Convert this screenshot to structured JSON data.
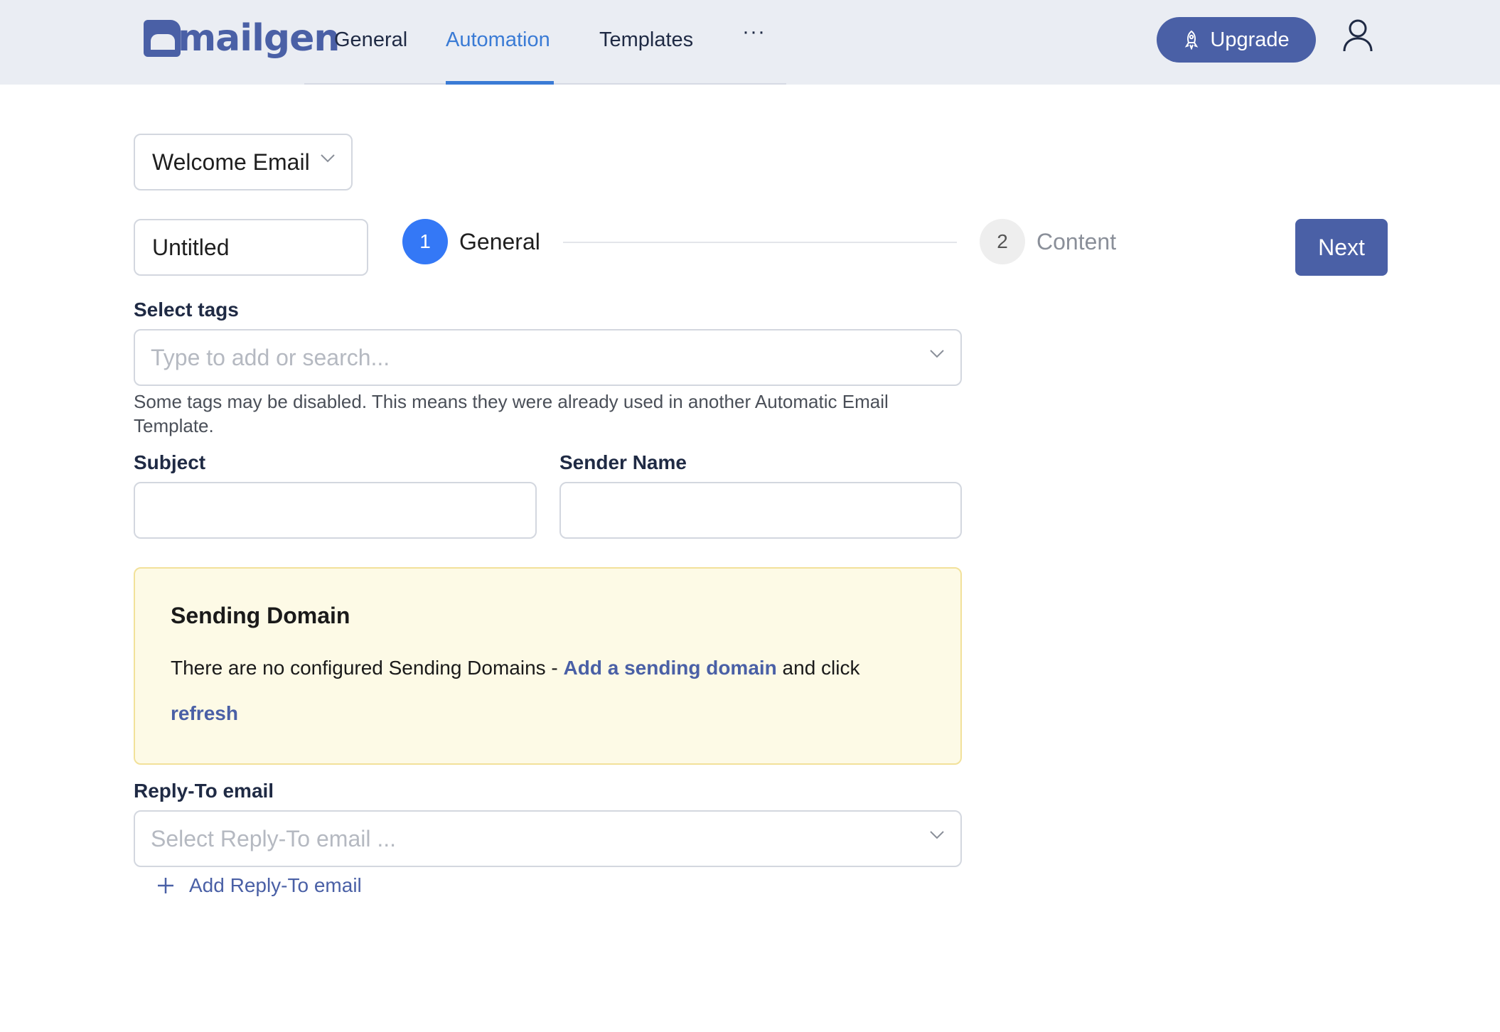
{
  "brand": {
    "name": "mailgen",
    "accent": "#4a60a6",
    "link_active": "#3a7bd5"
  },
  "nav": {
    "items": [
      {
        "label": "General"
      },
      {
        "label": "Automation",
        "active": true
      },
      {
        "label": "Templates"
      }
    ],
    "more_label": "···",
    "upgrade_label": "Upgrade",
    "upgrade_icon": "rocket-icon",
    "user_icon": "user-icon"
  },
  "template_select": {
    "value": "Welcome Email"
  },
  "name_field": {
    "value": "Untitled"
  },
  "steps": [
    {
      "number": "1",
      "label": "General",
      "state": "active"
    },
    {
      "number": "2",
      "label": "Content",
      "state": "inactive"
    }
  ],
  "next_label": "Next",
  "tags": {
    "label": "Select tags",
    "placeholder": "Type to add or search...",
    "hint": "Some tags may be disabled. This means they were already used in another Automatic Email Template."
  },
  "subject": {
    "label": "Subject",
    "value": ""
  },
  "sender_name": {
    "label": "Sender Name",
    "value": ""
  },
  "sending_domain": {
    "title": "Sending Domain",
    "text_before": "There are no configured Sending Domains - ",
    "link_add": "Add a sending domain",
    "text_after": " and click",
    "link_refresh": "refresh",
    "background": "#fdfae6"
  },
  "reply_to": {
    "label": "Reply-To email",
    "placeholder": "Select Reply-To email ...",
    "add_label": "Add Reply-To email"
  }
}
